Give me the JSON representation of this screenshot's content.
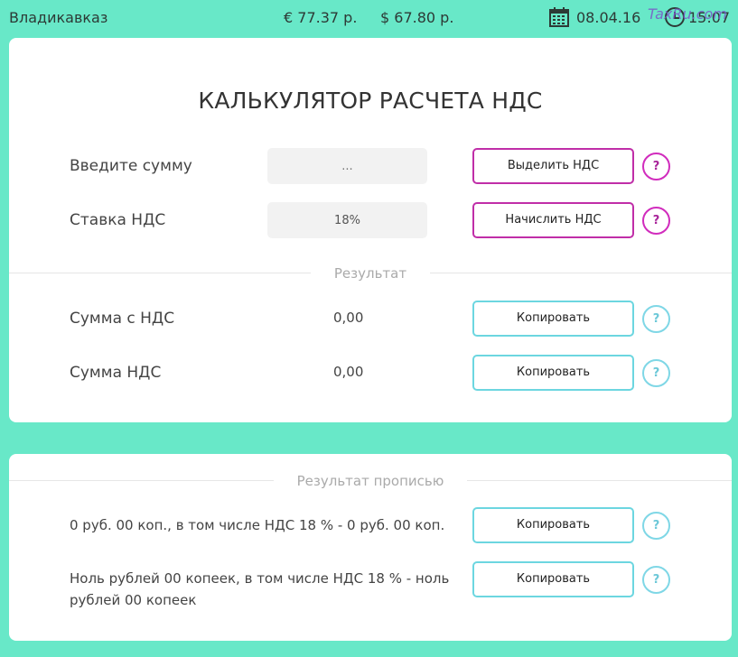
{
  "topbar": {
    "city": "Владикавказ",
    "eur_rate": "€ 77.37 р.",
    "usd_rate": "$ 67.80 р.",
    "date": "08.04.16",
    "time": "15:07",
    "watermark": "TaxRu.com"
  },
  "calculator": {
    "title": "КАЛЬКУЛЯТОР РАСЧЕТА НДС",
    "amount_label": "Введите сумму",
    "amount_placeholder": "...",
    "rate_label": "Ставка НДС",
    "rate_value": "18%",
    "extract_vat_button": "Выделить НДС",
    "add_vat_button": "Начислить НДС",
    "help_label": "?"
  },
  "result": {
    "section_label": "Результат",
    "rows": [
      {
        "label": "Сумма с НДС",
        "value": "0,00",
        "copy_label": "Копировать",
        "help_label": "?"
      },
      {
        "label": "Сумма НДС",
        "value": "0,00",
        "copy_label": "Копировать",
        "help_label": "?"
      }
    ]
  },
  "words": {
    "section_label": "Результат прописью",
    "rows": [
      {
        "text": "0 руб. 00 коп., в том числе НДС 18 % - 0 руб. 00 коп.",
        "copy_label": "Копировать",
        "help_label": "?"
      },
      {
        "text": "Ноль рублей 00 копеек, в том числе НДС 18 % - ноль рублей 00 копеек",
        "copy_label": "Копировать",
        "help_label": "?"
      }
    ]
  },
  "colors": {
    "background": "#68e8c8",
    "accent_purple": "#c02ea8",
    "accent_teal": "#6cd6e0"
  },
  "icons": {
    "calendar": "calendar-icon",
    "clock": "clock-icon"
  }
}
